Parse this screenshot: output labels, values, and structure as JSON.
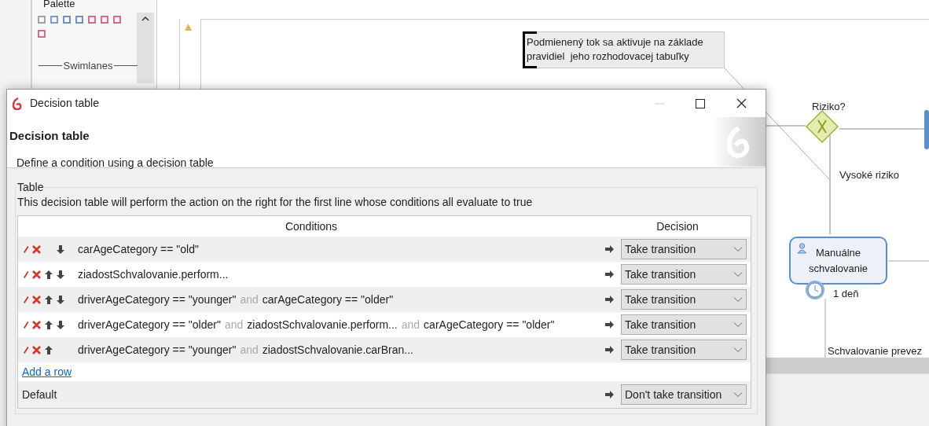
{
  "editor": {
    "palette": {
      "title": "Palette",
      "section": "Swimlanes"
    },
    "diagram": {
      "annotation_lines": [
        "Podmienený tok sa aktivuje na základe",
        "pravidiel  jeho rozhodovacej tabuľky"
      ],
      "gateway_label": "Riziko?",
      "flow_label": "Vysoké riziko",
      "task": "Manuálne schvalovanie",
      "timer_label": "1 deň",
      "flow_label_2": "Schvalovanie prevez"
    }
  },
  "dialog": {
    "title": "Decision table",
    "heading": "Decision table",
    "description": "Define a condition using a decision table",
    "group": "Table",
    "hint": "This decision table will perform the action on the right for the first line whose conditions all evaluate to true",
    "columns": [
      "Conditions",
      "Decision"
    ],
    "rows": [
      {
        "move_up": false,
        "move_down": true,
        "parts": [
          {
            "kind": "term",
            "text": "carAgeCategory == \"old\""
          }
        ],
        "decision": "Take transition"
      },
      {
        "move_up": true,
        "move_down": true,
        "parts": [
          {
            "kind": "term",
            "text": "ziadostSchvalovanie.perform..."
          }
        ],
        "decision": "Take transition"
      },
      {
        "move_up": true,
        "move_down": true,
        "parts": [
          {
            "kind": "term",
            "text": "driverAgeCategory == \"younger\""
          },
          {
            "kind": "and",
            "text": "and"
          },
          {
            "kind": "term",
            "text": "carAgeCategory == \"older\""
          }
        ],
        "decision": "Take transition"
      },
      {
        "move_up": true,
        "move_down": true,
        "parts": [
          {
            "kind": "term",
            "text": "driverAgeCategory == \"older\""
          },
          {
            "kind": "and",
            "text": "and"
          },
          {
            "kind": "term",
            "text": "ziadostSchvalovanie.perform..."
          },
          {
            "kind": "and",
            "text": "and"
          },
          {
            "kind": "term",
            "text": "carAgeCategory == \"older\""
          }
        ],
        "decision": "Take transition"
      },
      {
        "move_up": true,
        "move_down": false,
        "parts": [
          {
            "kind": "term",
            "text": "driverAgeCategory == \"younger\""
          },
          {
            "kind": "and",
            "text": "and"
          },
          {
            "kind": "term",
            "text": "ziadostSchvalovanie.carBran..."
          }
        ],
        "decision": "Take transition"
      }
    ],
    "add_row": "Add a row",
    "default": {
      "label": "Default",
      "decision": "Don't take transition"
    }
  }
}
